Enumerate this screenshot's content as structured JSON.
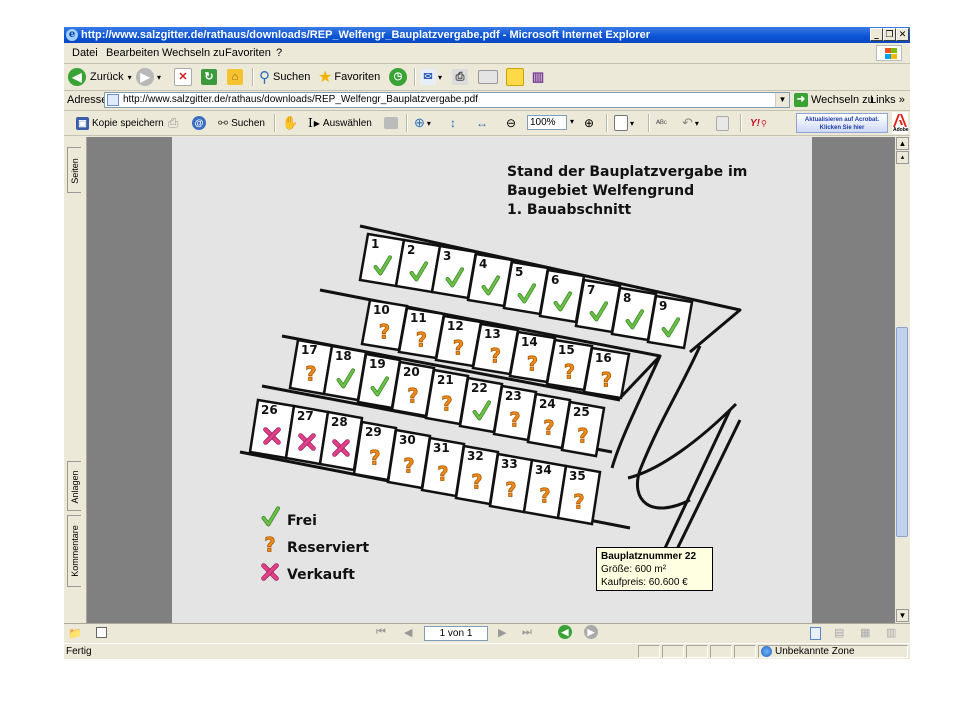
{
  "window": {
    "title": "http://www.salzgitter.de/rathaus/downloads/REP_Welfengr_Bauplatzvergabe.pdf - Microsoft Internet Explorer",
    "buttons": {
      "minimize": "_",
      "maximize": "❐",
      "close": "✕"
    }
  },
  "menu": [
    "Datei",
    "Bearbeiten",
    "Wechseln zu",
    "Favoriten",
    "?"
  ],
  "toolbar": {
    "back_label": "Zurück",
    "search_label": "Suchen",
    "favorites_label": "Favoriten"
  },
  "address": {
    "label": "Adresse",
    "url": "http://www.salzgitter.de/rathaus/downloads/REP_Welfengr_Bauplatzvergabe.pdf",
    "go_label": "Wechseln zu",
    "links_label": "Links »"
  },
  "reader": {
    "save_label": "Kopie speichern",
    "search_label": "Suchen",
    "select_label": "Auswählen",
    "zoom_value": "100%",
    "acrobat_line1": "Aktualisieren auf Acrobat.",
    "acrobat_line2": "Klicken Sie hier",
    "adobe_label": "Adobe"
  },
  "side_tabs": {
    "pages": "Seiten",
    "attachments": "Anlagen",
    "comments": "Kommentare"
  },
  "document": {
    "title_lines": [
      "Stand der Bauplatzvergabe im",
      "Baugebiet Welfengrund",
      "1. Bauabschnitt"
    ],
    "legend": [
      {
        "status": "F",
        "label": "Frei"
      },
      {
        "status": "R",
        "label": "Reserviert"
      },
      {
        "status": "V",
        "label": "Verkauft"
      }
    ],
    "plots_columns": [
      "id",
      "x",
      "y",
      "w",
      "h",
      "status"
    ],
    "plots": [
      [
        "1",
        360,
        234,
        36,
        46,
        "F"
      ],
      [
        "2",
        396,
        240,
        36,
        46,
        "F"
      ],
      [
        "3",
        432,
        246,
        36,
        46,
        "F"
      ],
      [
        "4",
        468,
        254,
        36,
        46,
        "F"
      ],
      [
        "5",
        504,
        262,
        36,
        46,
        "F"
      ],
      [
        "6",
        540,
        270,
        36,
        46,
        "F"
      ],
      [
        "7",
        576,
        280,
        36,
        46,
        "F"
      ],
      [
        "8",
        612,
        288,
        36,
        46,
        "F"
      ],
      [
        "9",
        648,
        296,
        36,
        46,
        "F"
      ],
      [
        "10",
        362,
        300,
        37,
        44,
        "R"
      ],
      [
        "11",
        399,
        308,
        37,
        44,
        "R"
      ],
      [
        "12",
        436,
        316,
        37,
        44,
        "R"
      ],
      [
        "13",
        473,
        324,
        37,
        44,
        "R"
      ],
      [
        "14",
        510,
        332,
        37,
        44,
        "R"
      ],
      [
        "15",
        547,
        340,
        37,
        44,
        "R"
      ],
      [
        "16",
        584,
        348,
        37,
        44,
        "R"
      ],
      [
        "17",
        290,
        340,
        34,
        48,
        "R"
      ],
      [
        "18",
        324,
        346,
        34,
        48,
        "F"
      ],
      [
        "19",
        358,
        354,
        34,
        48,
        "F"
      ],
      [
        "20",
        392,
        362,
        34,
        48,
        "R"
      ],
      [
        "21",
        426,
        370,
        34,
        48,
        "R"
      ],
      [
        "22",
        460,
        378,
        34,
        48,
        "F"
      ],
      [
        "23",
        494,
        386,
        34,
        48,
        "R"
      ],
      [
        "24",
        528,
        394,
        34,
        48,
        "R"
      ],
      [
        "25",
        562,
        402,
        34,
        48,
        "R"
      ],
      [
        "26",
        250,
        400,
        36,
        52,
        "V"
      ],
      [
        "27",
        286,
        406,
        34,
        52,
        "V"
      ],
      [
        "28",
        320,
        412,
        34,
        52,
        "V"
      ],
      [
        "29",
        354,
        422,
        34,
        52,
        "R"
      ],
      [
        "30",
        388,
        430,
        34,
        52,
        "R"
      ],
      [
        "31",
        422,
        438,
        34,
        52,
        "R"
      ],
      [
        "32",
        456,
        446,
        34,
        52,
        "R"
      ],
      [
        "33",
        490,
        454,
        34,
        52,
        "R"
      ],
      [
        "34",
        524,
        460,
        34,
        52,
        "R"
      ],
      [
        "35",
        558,
        466,
        34,
        52,
        "R"
      ]
    ]
  },
  "tooltip": {
    "title": "Bauplatznummer 22",
    "size": "Größe: 600 m²",
    "price": "Kaufpreis: 60.600 €"
  },
  "nav": {
    "page_display": "1 von 1"
  },
  "status": {
    "left": "Fertig",
    "zone": "Unbekannte Zone"
  },
  "colors": {
    "frei": "#6cc04a",
    "reserviert": "#f08a1c",
    "verkauft": "#e0408a",
    "titlebar": "#0b53d6"
  }
}
